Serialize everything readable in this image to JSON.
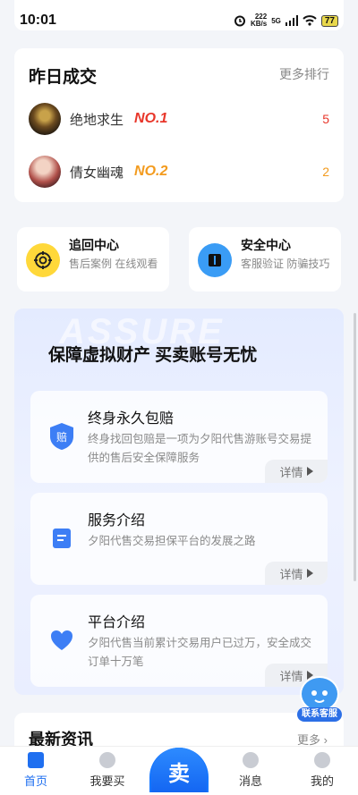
{
  "status_bar": {
    "time": "10:01",
    "speed_value": "222",
    "speed_unit": "KB/s",
    "network": "5G",
    "battery": "77"
  },
  "yesterday_deals": {
    "title": "昨日成交",
    "more_label": "更多排行",
    "items": [
      {
        "name": "绝地求生",
        "rank": "NO.1",
        "count": "5"
      },
      {
        "name": "倩女幽魂",
        "rank": "NO.2",
        "count": "2"
      }
    ]
  },
  "centers": [
    {
      "title": "追回中心",
      "desc": "售后案例 在线观看",
      "icon": "target-icon"
    },
    {
      "title": "安全中心",
      "desc": "客服验证 防骗技巧",
      "icon": "book-icon"
    }
  ],
  "assurance": {
    "watermark": "ASSURE",
    "title": "保障虚拟财产 买卖账号无忧",
    "features": [
      {
        "title": "终身永久包赔",
        "desc": "终身找回包赔是一项为夕阳代售游账号交易提供的售后安全保障服务",
        "detail": "详情",
        "badge": "赔"
      },
      {
        "title": "服务介绍",
        "desc": "夕阳代售交易担保平台的发展之路",
        "detail": "详情"
      },
      {
        "title": "平台介绍",
        "desc": "夕阳代售当前累计交易用户已过万，安全成交订单十万笔",
        "detail": "详情"
      }
    ]
  },
  "news": {
    "title": "最新资讯",
    "more_label": "更多"
  },
  "customer_service": {
    "label": "联系客服"
  },
  "tabbar": {
    "tabs": [
      {
        "label": "首页",
        "active": true
      },
      {
        "label": "我要买"
      },
      {
        "label": "卖"
      },
      {
        "label": "消息"
      },
      {
        "label": "我的"
      }
    ]
  },
  "colors": {
    "primary": "#1f6ff0",
    "rank1": "#e8362a",
    "rank2": "#f39b1e",
    "page_bg": "#f3f5f9"
  }
}
